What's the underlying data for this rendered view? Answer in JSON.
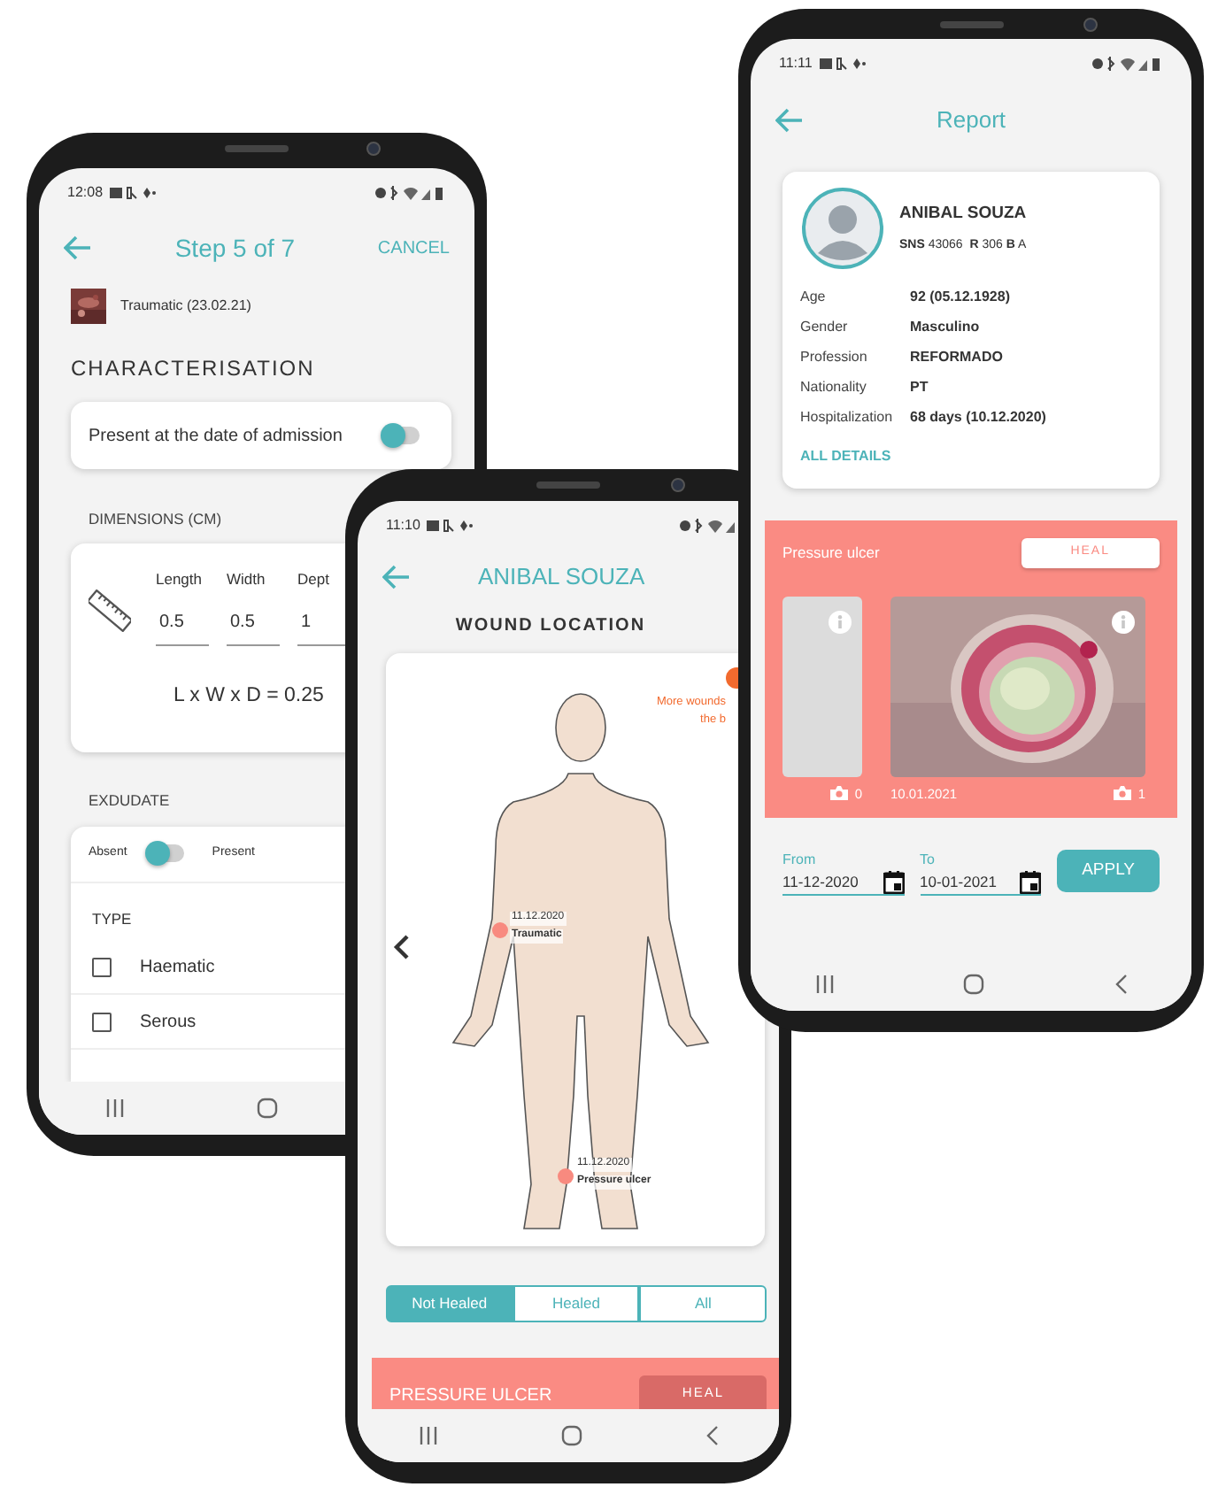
{
  "step_screen": {
    "status_time": "12:08",
    "title": "Step 5 of 7",
    "cancel": "CANCEL",
    "wound": {
      "label": "Traumatic (23.02.21)"
    },
    "section_title": "CHARACTERISATION",
    "admission": {
      "label": "Present at the date of admission",
      "on": false
    },
    "dimensions": {
      "title": "DIMENSIONS (CM)",
      "fields": [
        {
          "label": "Length",
          "value": "0.5"
        },
        {
          "label": "Width",
          "value": "0.5"
        },
        {
          "label": "Dept",
          "value": "1"
        }
      ],
      "formula": "L x W x D = 0.25"
    },
    "exudate": {
      "title": "EXDUDATE",
      "off_label": "Absent",
      "on_label": "Present",
      "on": false,
      "type_title": "TYPE",
      "types": [
        {
          "label": "Haematic",
          "checked": false
        },
        {
          "label": "Serous",
          "checked": false
        }
      ]
    }
  },
  "location_screen": {
    "status_time": "11:10",
    "title": "ANIBAL SOUZA",
    "section_title": "WOUND LOCATION",
    "more_wounds": [
      "More wounds",
      "the b"
    ],
    "wounds": [
      {
        "date": "11.12.2020",
        "label": "Traumatic"
      },
      {
        "date": "11.12.2020",
        "label": "Pressure ulcer"
      }
    ],
    "filters": [
      {
        "label": "Not Healed",
        "selected": true
      },
      {
        "label": "Healed",
        "selected": false
      },
      {
        "label": "All",
        "selected": false
      }
    ],
    "wound_bar": {
      "title": "PRESSURE ULCER",
      "action": "HEAL"
    }
  },
  "report_screen": {
    "status_time": "11:11",
    "title": "Report",
    "patient": {
      "name": "ANIBAL SOUZA",
      "ids": "**SNS** 43066  **R** 306 **B** A",
      "details": [
        {
          "label": "Age",
          "value": "92 (05.12.1928)"
        },
        {
          "label": "Gender",
          "value": "Masculino"
        },
        {
          "label": "Profession",
          "value": "REFORMADO"
        },
        {
          "label": "Nationality",
          "value": "PT"
        },
        {
          "label": "Hospitalization",
          "value": "68 days (10.12.2020)"
        }
      ],
      "link": "ALL DETAILS"
    },
    "wound": {
      "title": "Pressure ulcer",
      "action": "HEAL",
      "photos": [
        {
          "kind": "empty",
          "count": "0"
        },
        {
          "kind": "picture",
          "date": "10.01.2021",
          "count": "1"
        }
      ]
    },
    "filter": {
      "from_label": "From",
      "from": "11-12-2020",
      "to_label": "To",
      "to": "10-01-2021",
      "apply": "APPLY"
    }
  }
}
